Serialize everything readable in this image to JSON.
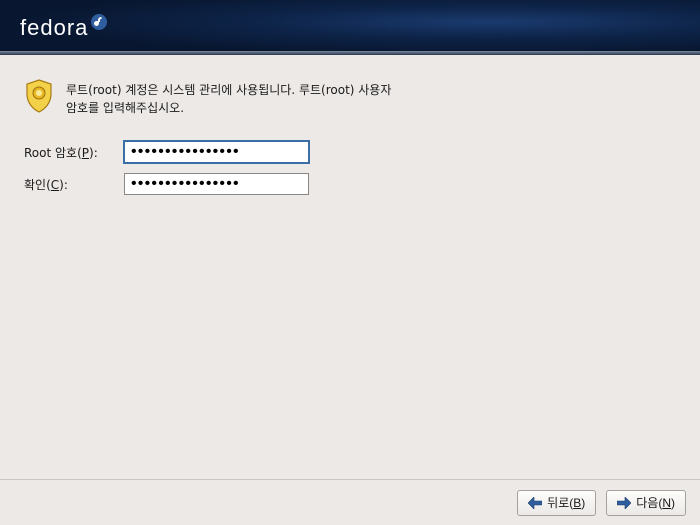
{
  "header": {
    "brand": "fedora"
  },
  "info": {
    "text": "루트(root) 계정은 시스템 관리에 사용됩니다. 루트(root) 사용자 암호를 입력해주십시오."
  },
  "form": {
    "password": {
      "label_pre": "Root 암호(",
      "label_accel": "P",
      "label_post": "):",
      "value": "••••••••••••••••"
    },
    "confirm": {
      "label_pre": "확인(",
      "label_accel": "C",
      "label_post": "):",
      "value": "••••••••••••••••"
    }
  },
  "footer": {
    "back": {
      "pre": "뒤로(",
      "accel": "B",
      "post": ")"
    },
    "next": {
      "pre": "다음(",
      "accel": "N",
      "post": ")"
    }
  }
}
